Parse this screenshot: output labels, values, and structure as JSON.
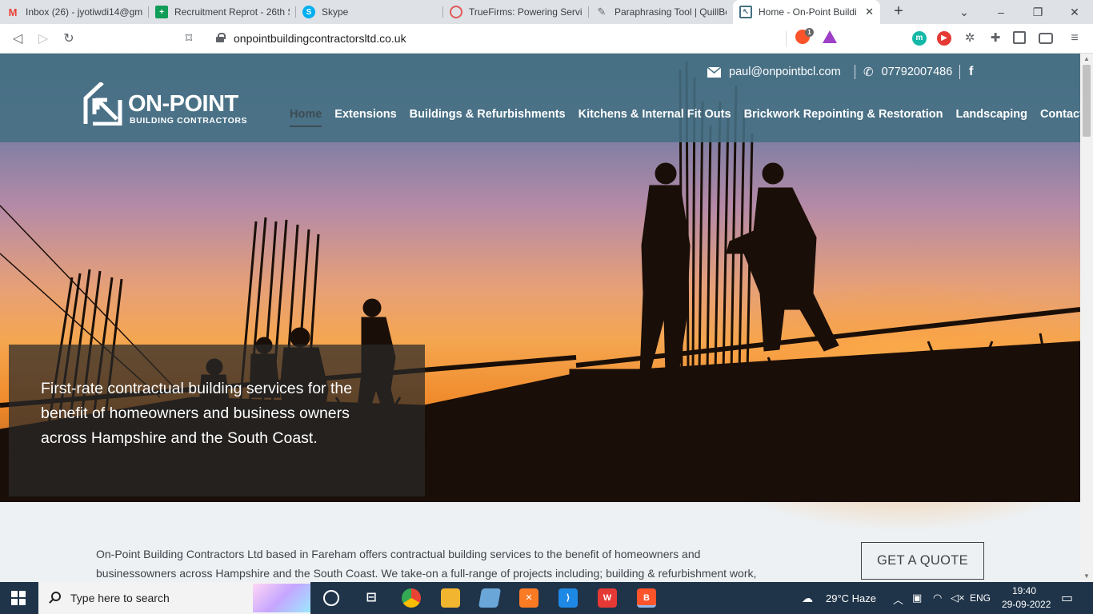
{
  "browser": {
    "tabs": [
      {
        "title": "Inbox (26) - jyotiwdi14@gm",
        "icon": "gmail-icon",
        "color": "#ea4335"
      },
      {
        "title": "Recruitment Reprot - 26th S",
        "icon": "sheets-icon",
        "color": "#0f9d58"
      },
      {
        "title": "Skype",
        "icon": "skype-icon",
        "color": "#00aff0"
      },
      {
        "title": "TrueFirms: Powering Service",
        "icon": "truefirms-icon",
        "color": "#e05a5a"
      },
      {
        "title": "Paraphrasing Tool | QuillBot",
        "icon": "quillbot-icon",
        "color": "#666666"
      },
      {
        "title": "Home - On-Point Buildi",
        "icon": "onpoint-icon",
        "color": "#447083"
      }
    ],
    "url": "onpointbuildingcontractorsltd.co.uk",
    "brave_badge": "1"
  },
  "site": {
    "logo": {
      "name": "ON-POINT",
      "sub": "BUILDING CONTRACTORS"
    },
    "email": "paul@onpointbcl.com",
    "phone": "07792007486",
    "nav": [
      {
        "label": "Home",
        "active": true
      },
      {
        "label": "Extensions"
      },
      {
        "label": "Buildings & Refurbishments"
      },
      {
        "label": "Kitchens & Internal Fit Outs"
      },
      {
        "label": "Brickwork Repointing & Restoration"
      },
      {
        "label": "Landscaping"
      },
      {
        "label": "Contact"
      }
    ],
    "hero_text": "First-rate contractual building services for the benefit of homeowners and business owners across Hampshire and the South Coast.",
    "intro_line1": "On-Point Building Contractors Ltd based in Fareham offers contractual building services to the benefit of homeowners and",
    "intro_line2": "businessowners across Hampshire and the South Coast. We take-on a full-range of projects including; building & refurbishment work,",
    "quote_button": "GET A QUOTE",
    "colors": {
      "header": "#447083",
      "text": "#3f4449"
    }
  },
  "taskbar": {
    "search_placeholder": "Type here to search",
    "weather": "29°C  Haze",
    "lang": "ENG",
    "time": "19:40",
    "date": "29-09-2022"
  }
}
